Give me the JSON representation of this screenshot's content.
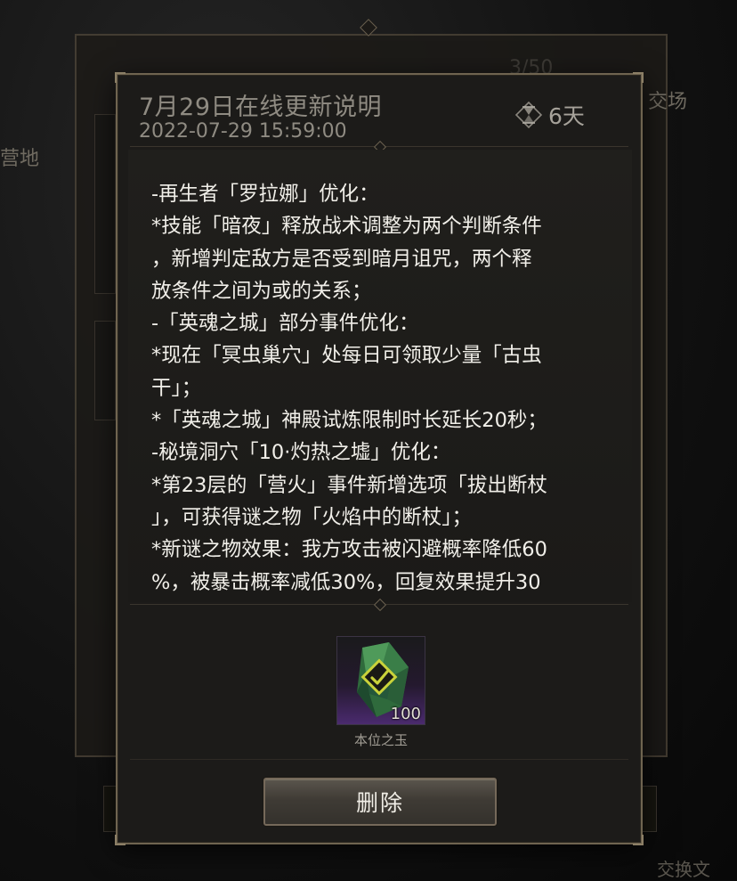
{
  "background": {
    "left_text": "营地",
    "right_text": "交场",
    "top_counter": "3/50",
    "bottom_right_text": "交换文"
  },
  "dialog": {
    "title": "7月29日在线更新说明",
    "date": "2022-07-29 15:59:00",
    "timer": {
      "icon": "hourglass-icon",
      "text": "6天"
    },
    "content_lines": [
      "-再生者「罗拉娜」优化：",
      "*技能「暗夜」释放战术调整为两个判断条件",
      "，新增判定敌方是否受到暗月诅咒，两个释",
      "放条件之间为或的关系；",
      "-「英魂之城」部分事件优化：",
      "*现在「冥虫巢穴」处每日可领取少量「古虫",
      "干」；",
      "*「英魂之城」神殿试炼限制时长延长20秒；",
      "-秘境洞穴「10·灼热之墟」优化：",
      "*第23层的「营火」事件新增选项「拔出断杖",
      "」，可获得谜之物「火焰中的断杖」；",
      "*新谜之物效果：我方攻击被闪避概率降低60",
      "%，被暴击概率减低30%，回复效果提升30"
    ],
    "attachment": {
      "icon": "green-gem-icon",
      "count": "100",
      "name": "本位之玉",
      "claimed": true
    },
    "delete_label": "删除"
  }
}
